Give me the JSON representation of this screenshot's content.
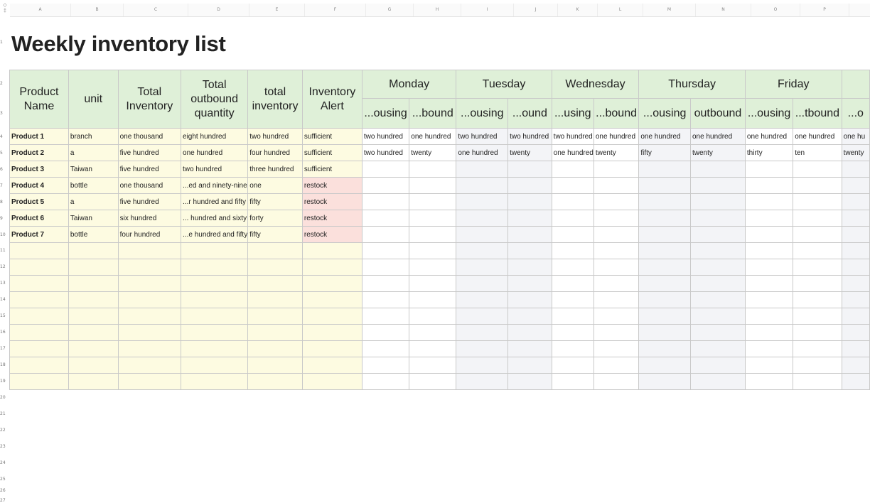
{
  "title": "Weekly inventory list",
  "column_letters": [
    "A",
    "B",
    "C",
    "D",
    "E",
    "F",
    "G",
    "H",
    "I",
    "J",
    "K",
    "L",
    "M",
    "N",
    "O",
    "P"
  ],
  "headers": {
    "product_name": "Product Name",
    "unit": "unit",
    "total_inventory": "Total Inventory",
    "total_outbound_quantity": "Total outbound quantity",
    "total_inventory_2": "total inventory",
    "inventory_alert": "Inventory Alert"
  },
  "days": [
    "Monday",
    "Tuesday",
    "Wednesday",
    "Thursday",
    "Friday"
  ],
  "sub_headers": [
    "...ousing",
    "...bound",
    "...ousing",
    "...ound",
    "...using",
    "...bound",
    "...ousing",
    "outbound",
    "...ousing",
    "...tbound",
    "...o"
  ],
  "rows": [
    {
      "name": "Product 1",
      "unit": "branch",
      "total": "one thousand",
      "outbound": "eight hundred",
      "inv": "two hundred",
      "alert": "sufficient",
      "alert_type": "ok",
      "days": [
        "two hundred",
        "one hundred",
        "two hundred",
        "two hundred",
        "two hundred",
        "one hundred",
        "one hundred",
        "one hundred",
        "one hundred",
        "one hundred",
        "one hu"
      ]
    },
    {
      "name": "Product 2",
      "unit": "a",
      "total": "five hundred",
      "outbound": "one hundred",
      "inv": "four hundred",
      "alert": "sufficient",
      "alert_type": "ok",
      "days": [
        "two hundred",
        "twenty",
        "one hundred",
        "twenty",
        "one hundred",
        "twenty",
        "fifty",
        "twenty",
        "thirty",
        "ten",
        "twenty"
      ]
    },
    {
      "name": "Product 3",
      "unit": "Taiwan",
      "total": "five hundred",
      "outbound": "two hundred",
      "inv": "three hundred",
      "alert": "sufficient",
      "alert_type": "ok",
      "days": [
        "",
        "",
        "",
        "",
        "",
        "",
        "",
        "",
        "",
        "",
        ""
      ]
    },
    {
      "name": "Product 4",
      "unit": "bottle",
      "total": "one thousand",
      "outbound": "...ed and ninety-nine",
      "inv": "one",
      "alert": "restock",
      "alert_type": "restock",
      "days": [
        "",
        "",
        "",
        "",
        "",
        "",
        "",
        "",
        "",
        "",
        ""
      ]
    },
    {
      "name": "Product 5",
      "unit": "a",
      "total": "five hundred",
      "outbound": "...r hundred and fifty",
      "inv": "fifty",
      "alert": "restock",
      "alert_type": "restock",
      "days": [
        "",
        "",
        "",
        "",
        "",
        "",
        "",
        "",
        "",
        "",
        ""
      ]
    },
    {
      "name": "Product 6",
      "unit": "Taiwan",
      "total": "six hundred",
      "outbound": "... hundred and sixty",
      "inv": "forty",
      "alert": "restock",
      "alert_type": "restock",
      "days": [
        "",
        "",
        "",
        "",
        "",
        "",
        "",
        "",
        "",
        "",
        ""
      ]
    },
    {
      "name": "Product 7",
      "unit": "bottle",
      "total": "four hundred",
      "outbound": "...e hundred and fifty",
      "inv": "fifty",
      "alert": "restock",
      "alert_type": "restock",
      "days": [
        "",
        "",
        "",
        "",
        "",
        "",
        "",
        "",
        "",
        "",
        ""
      ]
    }
  ],
  "row_numbers": [
    "1",
    "2",
    "3",
    "4",
    "5",
    "6",
    "7",
    "8",
    "9",
    "10",
    "11",
    "12",
    "13",
    "14",
    "15",
    "16",
    "17",
    "18",
    "19",
    "20",
    "21",
    "22",
    "23",
    "24",
    "25",
    "26",
    "27"
  ],
  "colors": {
    "header_green": "#dff0d8",
    "sheet_yellow": "#fdfbe1",
    "restock_red": "#fbe0dc",
    "day_alt_gray": "#f3f4f7"
  }
}
